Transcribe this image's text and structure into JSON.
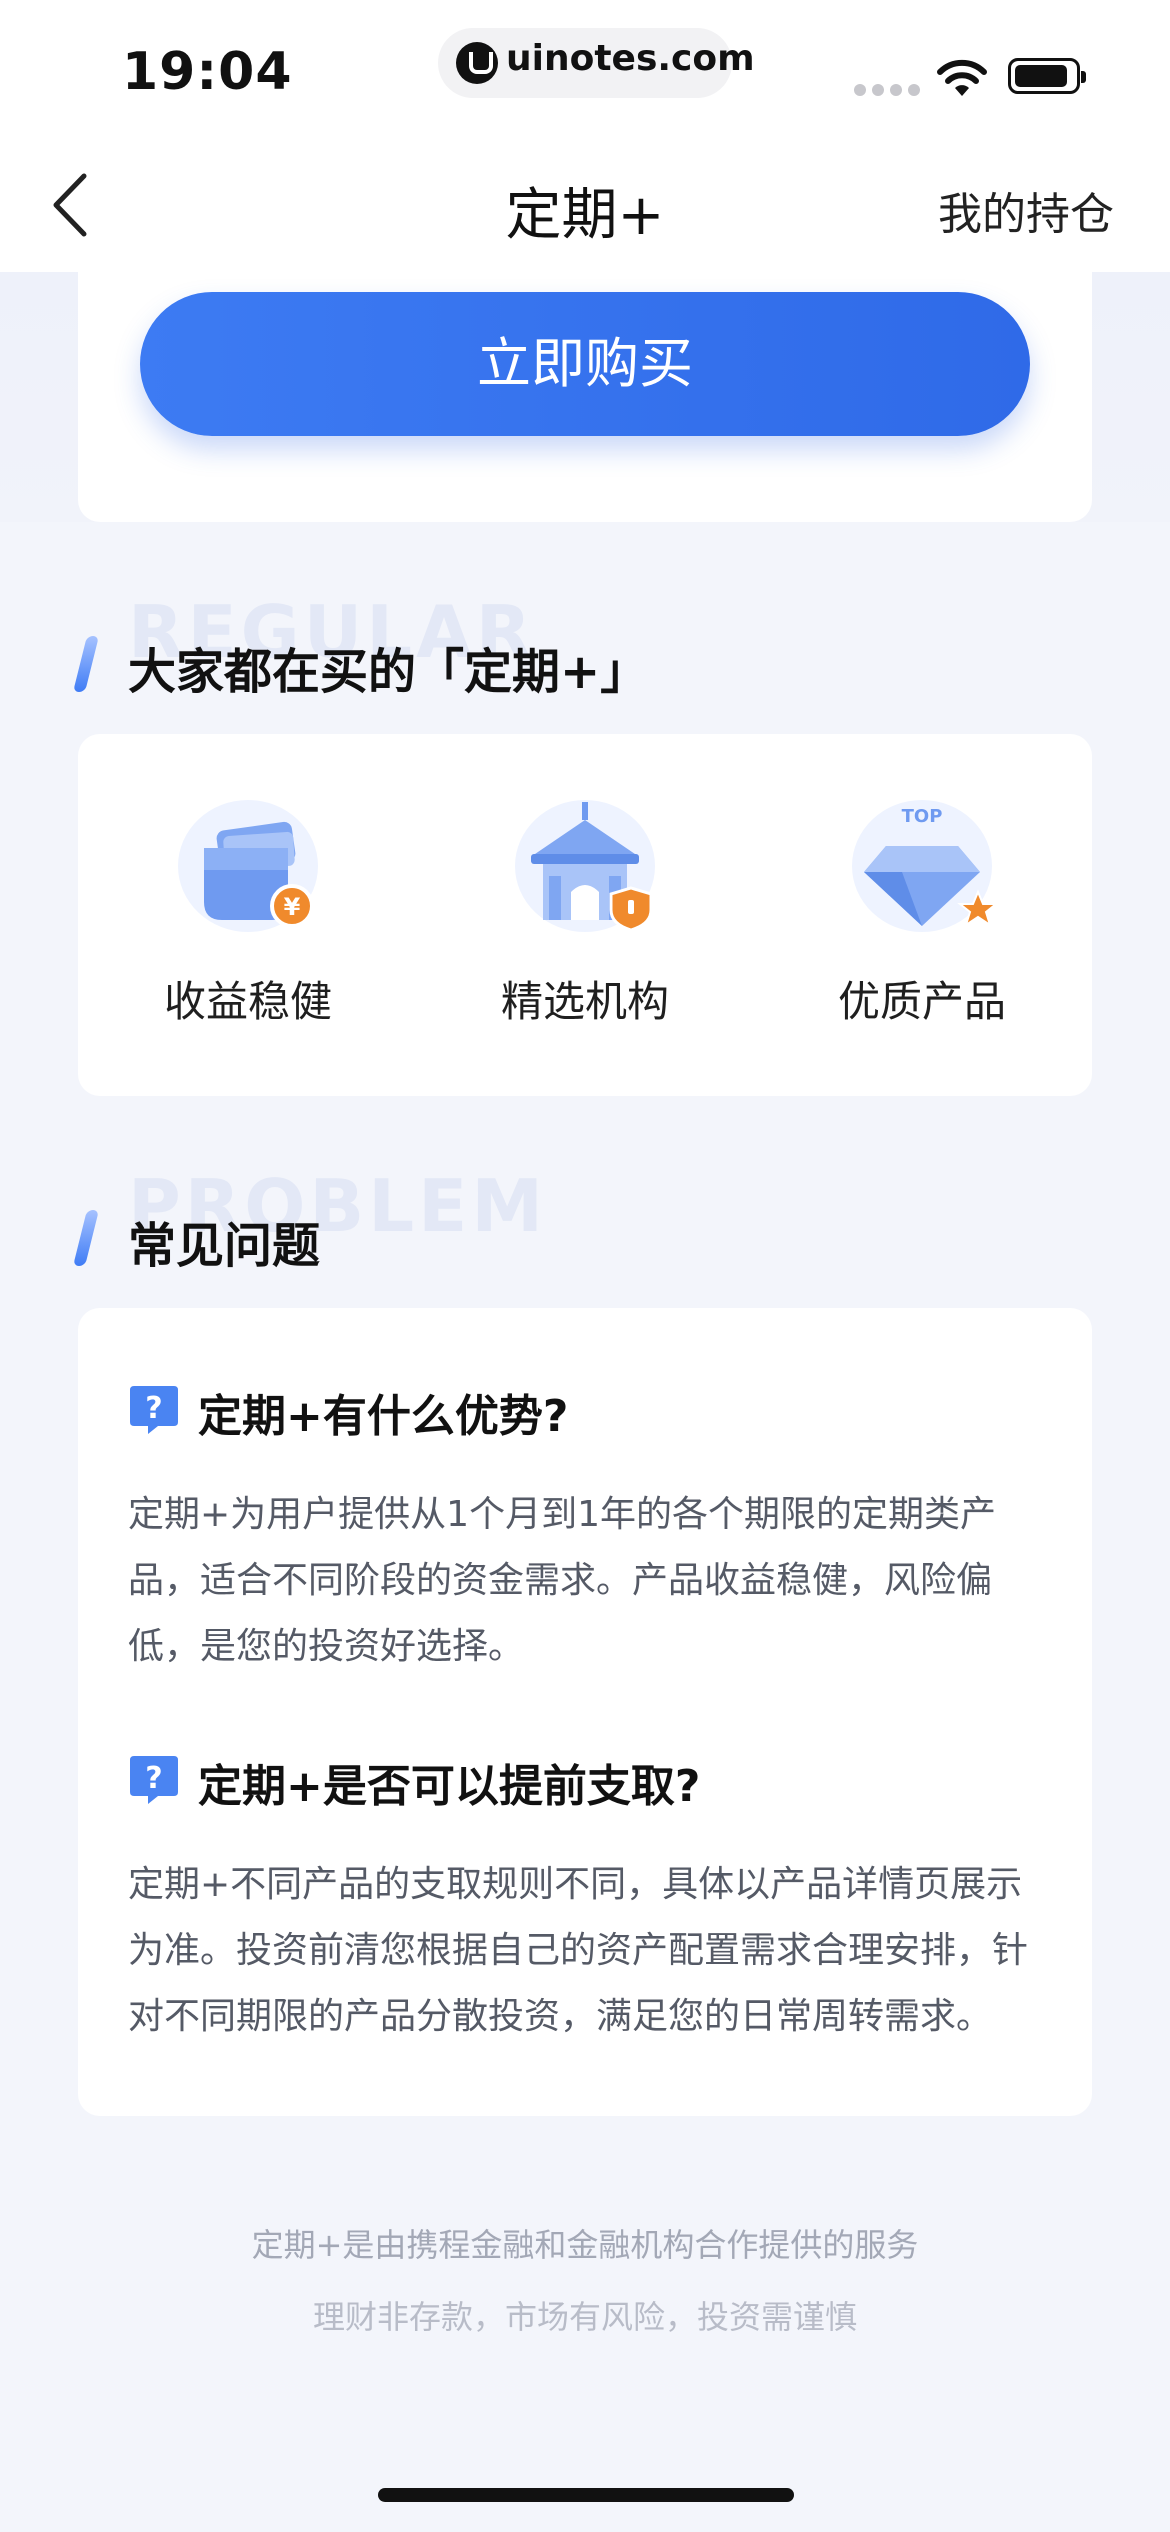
{
  "status_bar": {
    "time": "19:04",
    "url": "uinotes.com",
    "icons": [
      "signal-icon",
      "wifi-icon",
      "battery-icon"
    ]
  },
  "nav": {
    "back_icon": "chevron-left-icon",
    "title": "定期+",
    "right_label": "我的持仓"
  },
  "buy": {
    "button_label": "立即购买"
  },
  "features_section": {
    "bg_word": "REGULAR",
    "title": "大家都在买的「定期+」",
    "items": [
      {
        "label": "收益稳健",
        "icon": "wallet-yuan-icon"
      },
      {
        "label": "精选机构",
        "icon": "institution-shield-icon"
      },
      {
        "label": "优质产品",
        "icon": "diamond-top-star-icon",
        "badge": "TOP"
      }
    ]
  },
  "faq_section": {
    "bg_word": "PROBLEM",
    "title": "常见问题",
    "items": [
      {
        "question": "定期+有什么优势?",
        "answer_lines": [
          "定期+为用户提供从1个月到1年的各个期限的定期类产",
          "品，适合不同阶段的资金需求。产品收益稳健，风险偏",
          "低，是您的投资好选择。"
        ]
      },
      {
        "question": "定期+是否可以提前支取?",
        "answer_lines": [
          "定期+不同产品的支取规则不同，具体以产品详情页展示",
          "为准。投资前清您根据自己的资产配置需求合理安排，针",
          "对不同期限的产品分散投资，满足您的日常周转需求。"
        ]
      }
    ]
  },
  "footer": {
    "line1": "定期+是由携程金融和金融机构合作提供的服务",
    "line2": "理财非存款，市场有风险，投资需谨慎"
  },
  "colors": {
    "primary": "#3d7bf3",
    "background": "#f3f5fb",
    "card": "#ffffff",
    "accent_orange": "#f08a2c"
  }
}
